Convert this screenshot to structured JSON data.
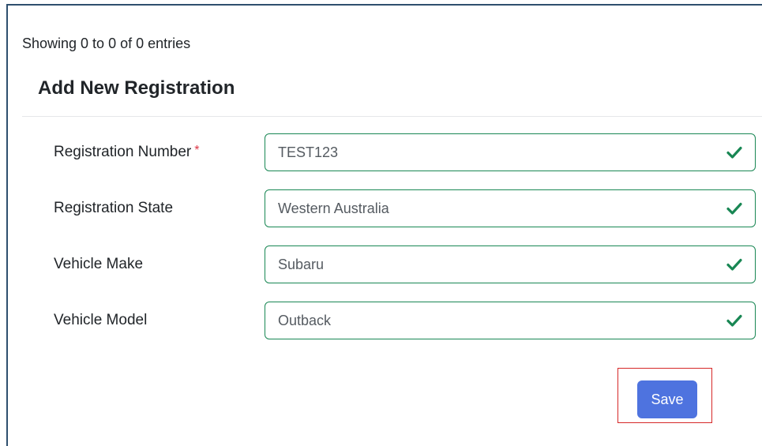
{
  "table": {
    "entries_info": "Showing 0 to 0 of 0 entries"
  },
  "modal": {
    "title": "Add New Registration",
    "fields": [
      {
        "label": "Registration Number",
        "required_marker": "*",
        "value": "TEST123",
        "status_icon": "checkmark-icon"
      },
      {
        "label": "Registration State",
        "value": "Western Australia",
        "status_icon": "checkmark-icon"
      },
      {
        "label": "Vehicle Make",
        "value": "Subaru",
        "status_icon": "checkmark-icon"
      },
      {
        "label": "Vehicle Model",
        "value": "Outback",
        "status_icon": "checkmark-icon"
      }
    ],
    "save_label": "Save"
  },
  "colors": {
    "valid_border": "#198754",
    "required_star": "#dc3545",
    "save_button": "#4e73df",
    "highlight_box": "#d62828"
  }
}
